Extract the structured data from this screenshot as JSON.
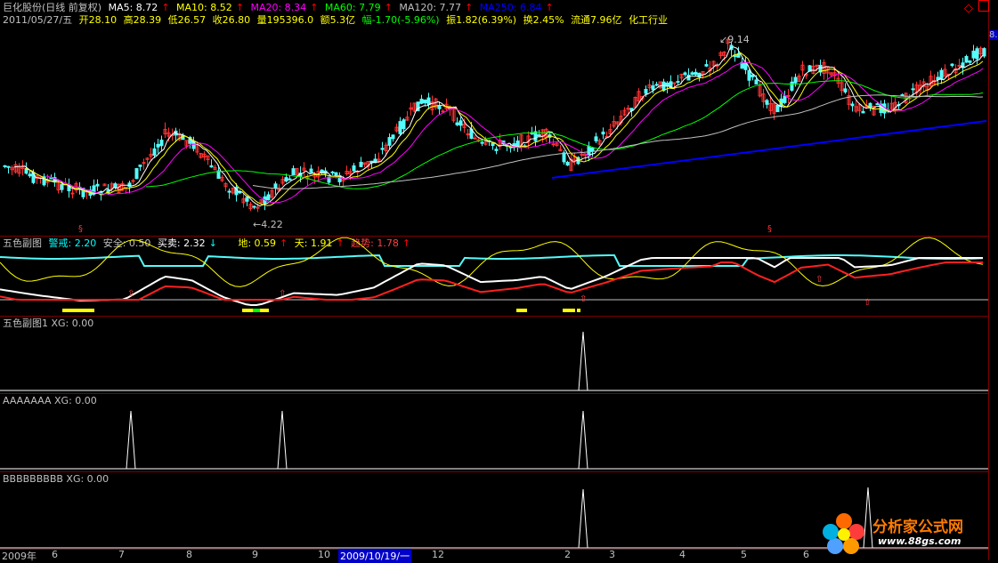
{
  "main": {
    "title": "巨化股份(日线 前复权)",
    "ma": [
      {
        "label": "MA5: 8.72",
        "color": "#ffffff"
      },
      {
        "label": "MA10: 8.52",
        "color": "#ffff00"
      },
      {
        "label": "MA20: 8.34",
        "color": "#ff00ff"
      },
      {
        "label": "MA60: 7.79",
        "color": "#00ff00"
      },
      {
        "label": "MA120: 7.77",
        "color": "#c0c0c0"
      },
      {
        "label": "MA250: 6.84",
        "color": "#0000ff"
      }
    ],
    "quote": {
      "date": "2011/05/27/五",
      "open": "开28.10",
      "high": "高28.39",
      "low": "低26.57",
      "close": "收26.80",
      "vol": "量195396.0",
      "amount": "额5.3亿",
      "change": "幅-1.70(-5.96%)",
      "amp": "振1.82(6.39%)",
      "turnover": "换2.45%",
      "float": "流通7.96亿",
      "industry": "化工行业"
    },
    "high_mark": "9.14",
    "low_mark": "4.22",
    "right_price": "8."
  },
  "sub1": {
    "title": "五色副图",
    "items": [
      {
        "label": "警戒: 2.20",
        "color": "#00ffff"
      },
      {
        "label": "安全: 0.50",
        "color": "#c0c0c0"
      },
      {
        "label": "买卖: 2.32",
        "color": "#ffffff"
      },
      {
        "label": "地: 0.59",
        "color": "#ffff00"
      },
      {
        "label": "天: 1.91",
        "color": "#ffff00"
      },
      {
        "label": "趋势: 1.78",
        "color": "#ff4040"
      }
    ]
  },
  "sub2": {
    "title": "五色副图1 XG: 0.00"
  },
  "sub3": {
    "title": "AAAAAAA XG: 0.00"
  },
  "sub4": {
    "title": "BBBBBBBBB XG: 0.00"
  },
  "axis": {
    "labels": [
      "2009年",
      "6",
      "7",
      "8",
      "9",
      "10",
      "12",
      "2",
      "3",
      "4",
      "5",
      "6"
    ],
    "current_date": "2009/10/19/一"
  },
  "logo": {
    "text": "分析家公式网",
    "url": "www.88gs.com"
  },
  "colors": {
    "up": "#ff3232",
    "down": "#54fcfc",
    "frame": "#800000"
  }
}
